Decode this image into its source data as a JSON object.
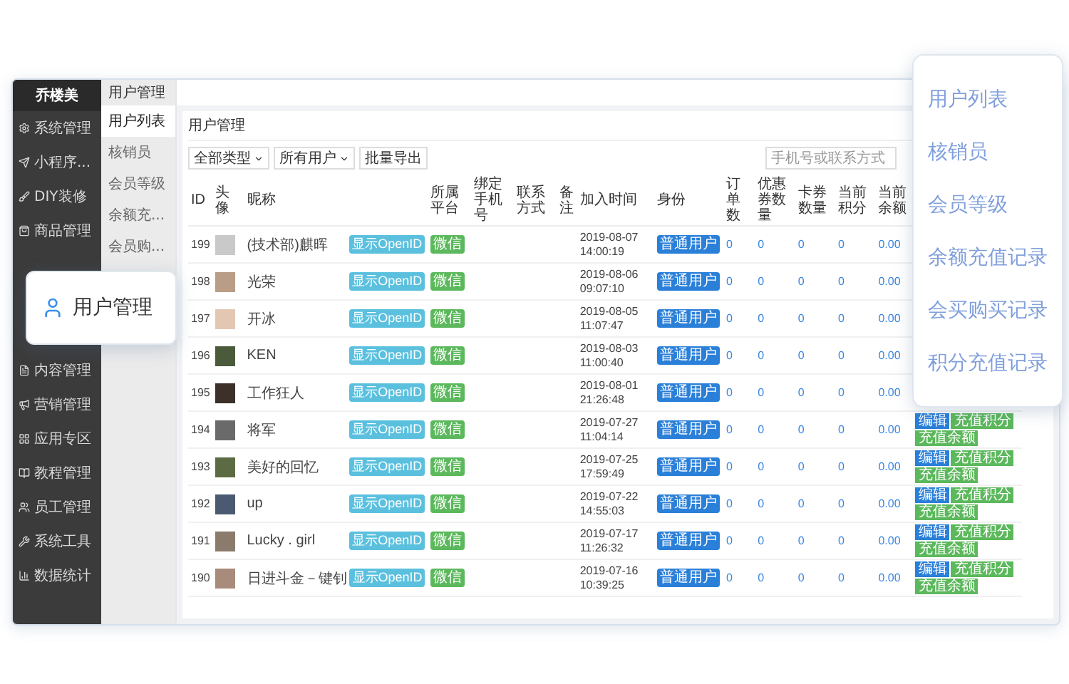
{
  "sidebar": {
    "logo": "乔楼美",
    "items": [
      {
        "label": "系统管理"
      },
      {
        "label": "小程序..."
      },
      {
        "label": "DIY装修"
      },
      {
        "label": "商品管理"
      },
      {
        "label": "内容管理"
      },
      {
        "label": "营销管理"
      },
      {
        "label": "应用专区"
      },
      {
        "label": "教程管理"
      },
      {
        "label": "员工管理"
      },
      {
        "label": "系统工具"
      },
      {
        "label": "数据统计"
      }
    ]
  },
  "submenu": {
    "title": "用户管理",
    "items": [
      {
        "label": "用户列表",
        "selected": true
      },
      {
        "label": "核销员",
        "selected": false
      },
      {
        "label": "会员等级",
        "selected": false
      },
      {
        "label": "余额充...",
        "selected": false
      },
      {
        "label": "会员购...",
        "selected": false
      }
    ]
  },
  "panel": {
    "title": "用户管理"
  },
  "toolbar": {
    "dropdowns": [
      "全部类型",
      "所有用户"
    ],
    "export_button": "批量导出",
    "search": {
      "placeholder": "手机号或联系方式"
    }
  },
  "table": {
    "columns": [
      "ID",
      "头像",
      "昵称",
      "所属平台",
      "绑定手机号",
      "联系方式",
      "备注",
      "加入时间",
      "身份",
      "订单数",
      "优惠券数量",
      "卡券数量",
      "当前积分",
      "当前余额"
    ],
    "rows": [
      {
        "id": "199",
        "nickname": "(技术部)麒晖",
        "openid": "显示OpenID",
        "platform": "微信",
        "joined": "2019-08-07 14:00:19",
        "identity": "普通用户",
        "orders": "0",
        "coupons": "0",
        "cards": "0",
        "points": "0",
        "balance": "0.00"
      },
      {
        "id": "198",
        "nickname": "光荣",
        "openid": "显示OpenID",
        "platform": "微信",
        "joined": "2019-08-06 09:07:10",
        "identity": "普通用户",
        "orders": "0",
        "coupons": "0",
        "cards": "0",
        "points": "0",
        "balance": "0.00"
      },
      {
        "id": "197",
        "nickname": "开冰",
        "openid": "显示OpenID",
        "platform": "微信",
        "joined": "2019-08-05 11:07:47",
        "identity": "普通用户",
        "orders": "0",
        "coupons": "0",
        "cards": "0",
        "points": "0",
        "balance": "0.00"
      },
      {
        "id": "196",
        "nickname": "KEN",
        "openid": "显示OpenID",
        "platform": "微信",
        "joined": "2019-08-03 11:00:40",
        "identity": "普通用户",
        "orders": "0",
        "coupons": "0",
        "cards": "0",
        "points": "0",
        "balance": "0.00"
      },
      {
        "id": "195",
        "nickname": "工作狂人",
        "openid": "显示OpenID",
        "platform": "微信",
        "joined": "2019-08-01 21:26:48",
        "identity": "普通用户",
        "orders": "0",
        "coupons": "0",
        "cards": "0",
        "points": "0",
        "balance": "0.00"
      },
      {
        "id": "194",
        "nickname": "将军",
        "openid": "显示OpenID",
        "platform": "微信",
        "joined": "2019-07-27 11:04:14",
        "identity": "普通用户",
        "orders": "0",
        "coupons": "0",
        "cards": "0",
        "points": "0",
        "balance": "0.00",
        "actions": [
          "编辑",
          "充值积分",
          "充值余额"
        ]
      },
      {
        "id": "193",
        "nickname": "美好的回忆",
        "openid": "显示OpenID",
        "platform": "微信",
        "joined": "2019-07-25 17:59:49",
        "identity": "普通用户",
        "orders": "0",
        "coupons": "0",
        "cards": "0",
        "points": "0",
        "balance": "0.00",
        "actions": [
          "编辑",
          "充值积分",
          "充值余额"
        ]
      },
      {
        "id": "192",
        "nickname": "up",
        "openid": "显示OpenID",
        "platform": "微信",
        "joined": "2019-07-22 14:55:03",
        "identity": "普通用户",
        "orders": "0",
        "coupons": "0",
        "cards": "0",
        "points": "0",
        "balance": "0.00",
        "actions": [
          "编辑",
          "充值积分",
          "充值余额"
        ]
      },
      {
        "id": "191",
        "nickname": "Lucky . girl",
        "openid": "显示OpenID",
        "platform": "微信",
        "joined": "2019-07-17 11:26:32",
        "identity": "普通用户",
        "orders": "0",
        "coupons": "0",
        "cards": "0",
        "points": "0",
        "balance": "0.00",
        "actions": [
          "编辑",
          "充值积分",
          "充值余额"
        ]
      },
      {
        "id": "190",
        "nickname": "日进斗金－键钊",
        "openid": "显示OpenID",
        "platform": "微信",
        "joined": "2019-07-16 10:39:25",
        "identity": "普通用户",
        "orders": "0",
        "coupons": "0",
        "cards": "0",
        "points": "0",
        "balance": "0.00",
        "actions": [
          "编辑",
          "充值积分",
          "充值余额"
        ]
      }
    ]
  },
  "callout_left": {
    "label": "用户管理"
  },
  "callout_right": {
    "items": [
      "用户列表",
      "核销员",
      "会员等级",
      "余额充值记录",
      "会买购买记录",
      "积分充值记录"
    ]
  }
}
